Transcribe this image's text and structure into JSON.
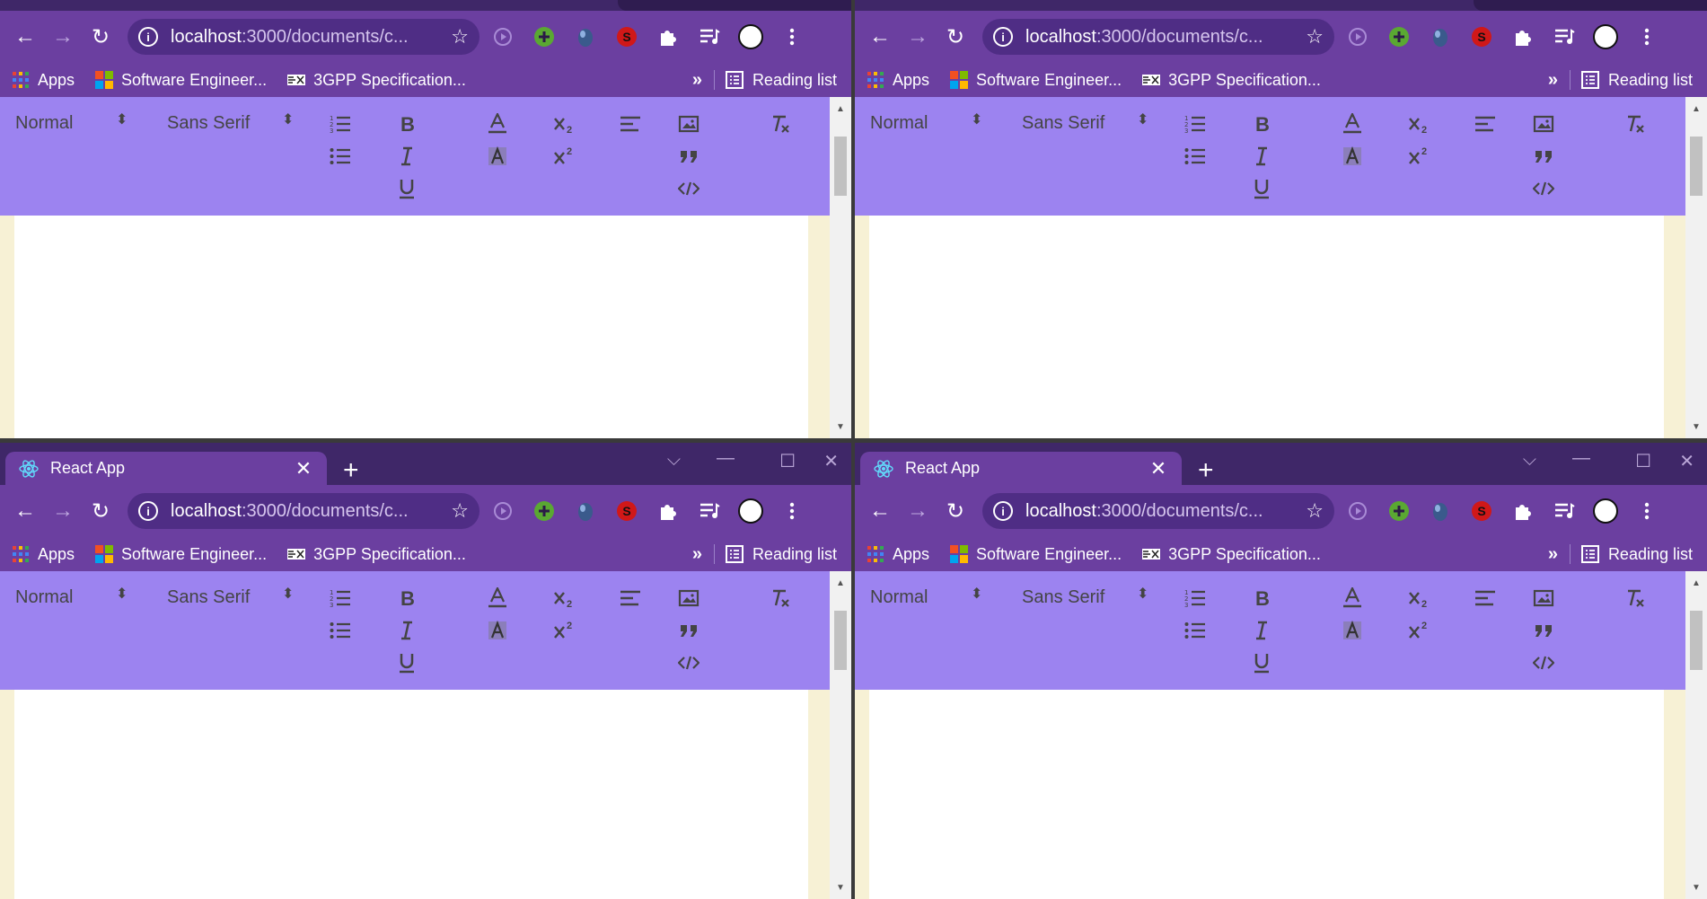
{
  "windows": [
    {
      "has_tab": false
    },
    {
      "has_tab": false
    },
    {
      "has_tab": true
    },
    {
      "has_tab": true
    }
  ],
  "tab": {
    "title": "React App",
    "close": "✕",
    "new_tab": "+"
  },
  "window_controls": {
    "tabsearch": "⌵",
    "minimize": "—",
    "maximize": "☐",
    "close": "✕"
  },
  "nav": {
    "back": "←",
    "forward": "→",
    "reload": "↻"
  },
  "omnibox": {
    "url_host": "localhost",
    "url_rest": ":3000/documents/c...",
    "info": "i",
    "star": "☆"
  },
  "extensions": [
    "play-extension-icon",
    "green-plus-extension-icon",
    "mouse-extension-icon",
    "red-s-extension-icon",
    "puzzle-extensions-icon",
    "media-queue-icon",
    "profile-avatar-icon",
    "kebab-menu-icon"
  ],
  "bookmarks": [
    {
      "label": "Apps",
      "icon": "apps-grid-icon"
    },
    {
      "label": "Software Engineer...",
      "icon": "microsoft-logo-icon"
    },
    {
      "label": "3GPP Specification...",
      "icon": "3gpp-logo-icon"
    }
  ],
  "bookmark_overflow": "»",
  "reading_list": "Reading list",
  "editor": {
    "header_select": "Normal",
    "font_select": "Sans Serif",
    "select_arrows": "⬍",
    "scroll_up": "▲",
    "scroll_down": "▼"
  },
  "colors": {
    "chrome_frame": "#6b3fa0",
    "tabstrip": "#3f2768",
    "editor_toolbar": "#9c83f0",
    "page_bg": "#f7f1d5"
  }
}
